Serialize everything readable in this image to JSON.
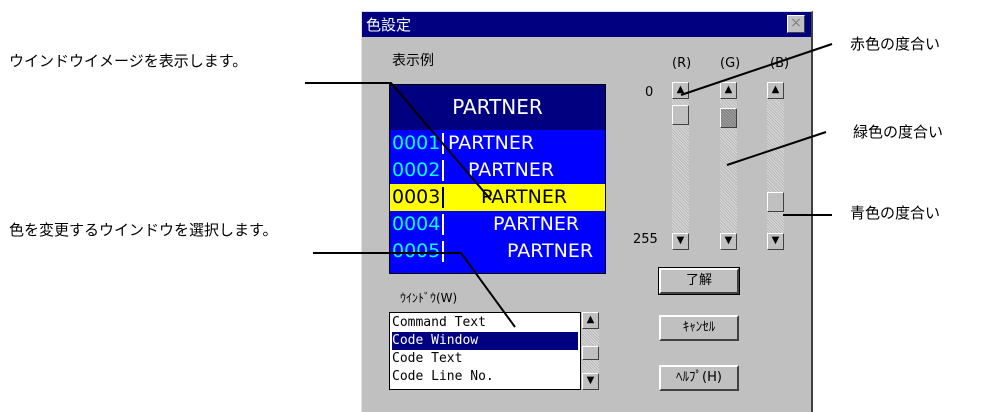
{
  "callouts": {
    "window_image": "ウインドウイメージを表示します。",
    "select_window": "色を変更するウインドウを選択します。",
    "red": "赤色の度合い",
    "green": "緑色の度合い",
    "blue": "青色の度合い"
  },
  "dialog": {
    "title": "色設定",
    "close_label": "×",
    "preview_label": "表示例",
    "preview": {
      "header": "PARTNER",
      "rows": [
        {
          "num": "0001",
          "text": "PARTNER"
        },
        {
          "num": "0002",
          "text": "PARTNER"
        },
        {
          "num": "0003",
          "text": "PARTNER"
        },
        {
          "num": "0004",
          "text": "PARTNER"
        },
        {
          "num": "0005",
          "text": "PARTNER"
        }
      ]
    },
    "sliders": {
      "r_label": "(R)",
      "g_label": "(G)",
      "b_label": "(B)",
      "min_label": "0",
      "max_label": "255",
      "r_level": 0.05,
      "g_level": 0.08,
      "b_level": 0.82
    },
    "window_label": "ｳｲﾝﾄﾞｳ(W)",
    "window_list": [
      "Command Text",
      "Code Window",
      "Code Text",
      "Code Line No."
    ],
    "selected_window": "Code Window",
    "buttons": {
      "ok": "了解",
      "cancel": "ｷｬﾝｾﾙ",
      "help": "ﾍﾙﾌﾟ(H)"
    },
    "colors": {
      "title_bar": "#000080",
      "preview_bg": "#0000ff",
      "highlight": "#ffff00",
      "line_number": "#00ffff"
    }
  }
}
